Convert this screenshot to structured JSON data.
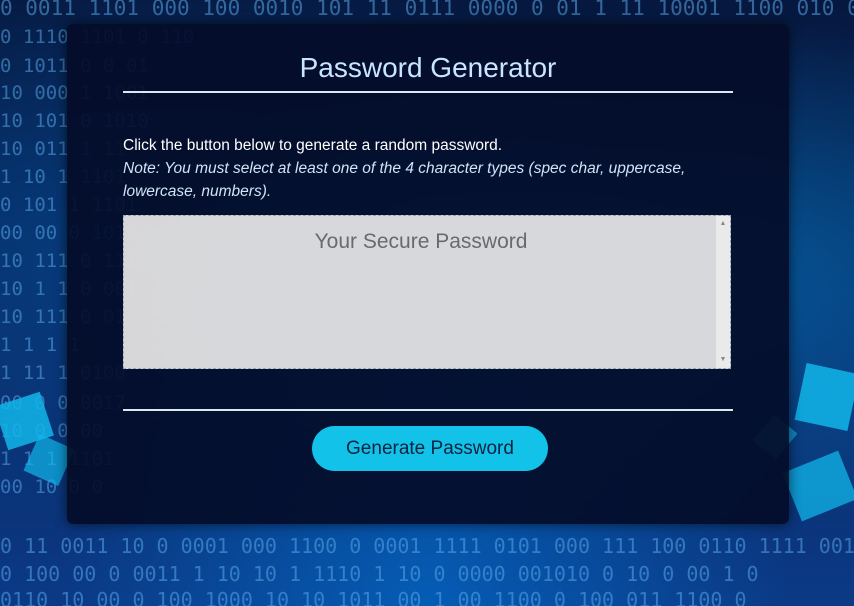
{
  "page": {
    "title": "Password Generator"
  },
  "instructions": {
    "line": "Click the button below to generate a random password.",
    "note": "Note: You must select at least one of the 4 character types (spec char, uppercase, lowercase, numbers)."
  },
  "password": {
    "placeholder": "Your Secure Password",
    "value": ""
  },
  "actions": {
    "generate_label": "Generate Password"
  },
  "colors": {
    "accent": "#12c2e8",
    "card_background": "#040c28",
    "title_text": "#c8e6ff",
    "textarea_background": "#e4e4e6"
  },
  "icons": {
    "scroll_up": "scroll-up-arrow-icon",
    "scroll_down": "scroll-down-arrow-icon"
  }
}
